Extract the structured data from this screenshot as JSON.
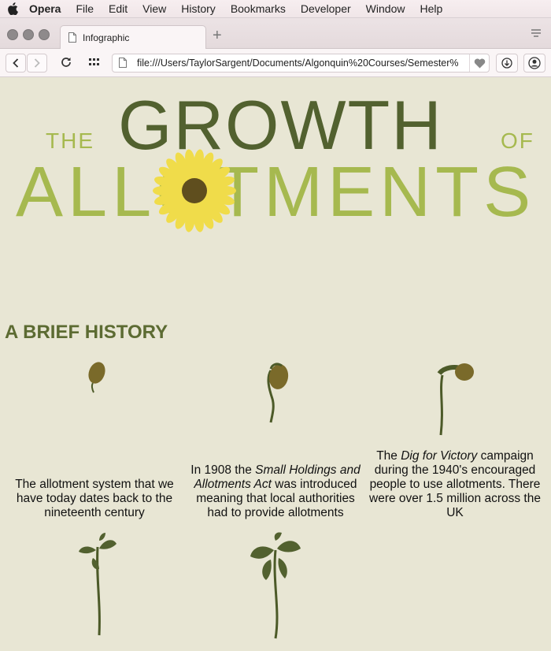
{
  "menubar": {
    "app": "Opera",
    "items": [
      "File",
      "Edit",
      "View",
      "History",
      "Bookmarks",
      "Developer",
      "Window",
      "Help"
    ]
  },
  "tab": {
    "title": "Infographic"
  },
  "address": {
    "url": "file:///Users/TaylorSargent/Documents/Algonquin%20Courses/Semester%"
  },
  "page": {
    "title_the": "THE",
    "title_growth": "GROWTH",
    "title_of": "OF",
    "title_allotments": "ALLOTMENTS",
    "section_heading": "A BRIEF HISTORY",
    "captions": [
      {
        "text": "The allotment system that we have today dates back to the nineteenth century"
      },
      {
        "pre": "In 1908 the ",
        "em": "Small Holdings and Allotments Act",
        "post": " was introduced meaning that local authorities had to provide allotments"
      },
      {
        "pre": "The ",
        "em": "Dig for Victory",
        "post": " campaign during the 1940's encouraged people to use allotments. There were over 1.5 million across the UK"
      }
    ]
  },
  "colors": {
    "background": "#e8e6d4",
    "dark_green": "#52612f",
    "light_green": "#a6b94f",
    "sunflower_yellow": "#f0dc4a",
    "seed_brown": "#7a6a2a"
  },
  "icons": [
    "apple-icon",
    "page-icon",
    "back-icon",
    "forward-icon",
    "reload-icon",
    "speed-dial-icon",
    "heart-icon",
    "download-icon",
    "account-icon",
    "tab-menu-icon"
  ]
}
